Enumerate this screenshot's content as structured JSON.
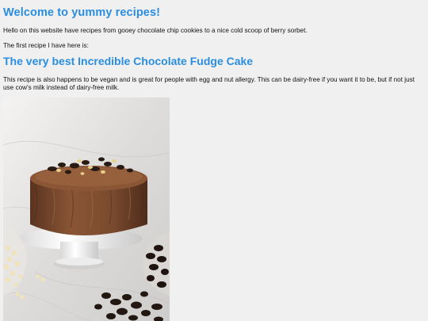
{
  "page": {
    "heading": "Welcome to yummy recipes!",
    "intro": "Hello on this website have recipes from gooey chocolate chip cookies to a nice cold scoop of berry sorbet.",
    "first_recipe_line": "The first recipe I have here is:"
  },
  "recipe": {
    "title": "The very best Incredible Chocolate Fudge Cake",
    "description": "This recipe is also happens to be vegan and is great for people with egg and nut allergy. This can be dairy-free if you want it to be, but if not just use cow's milk instead of dairy-free milk."
  },
  "colors": {
    "heading": "#2a8ee0",
    "background": "#f0f0f0",
    "frosting": "#7a4a2e"
  },
  "image": {
    "subject": "chocolate-fudge-cake-photo"
  }
}
